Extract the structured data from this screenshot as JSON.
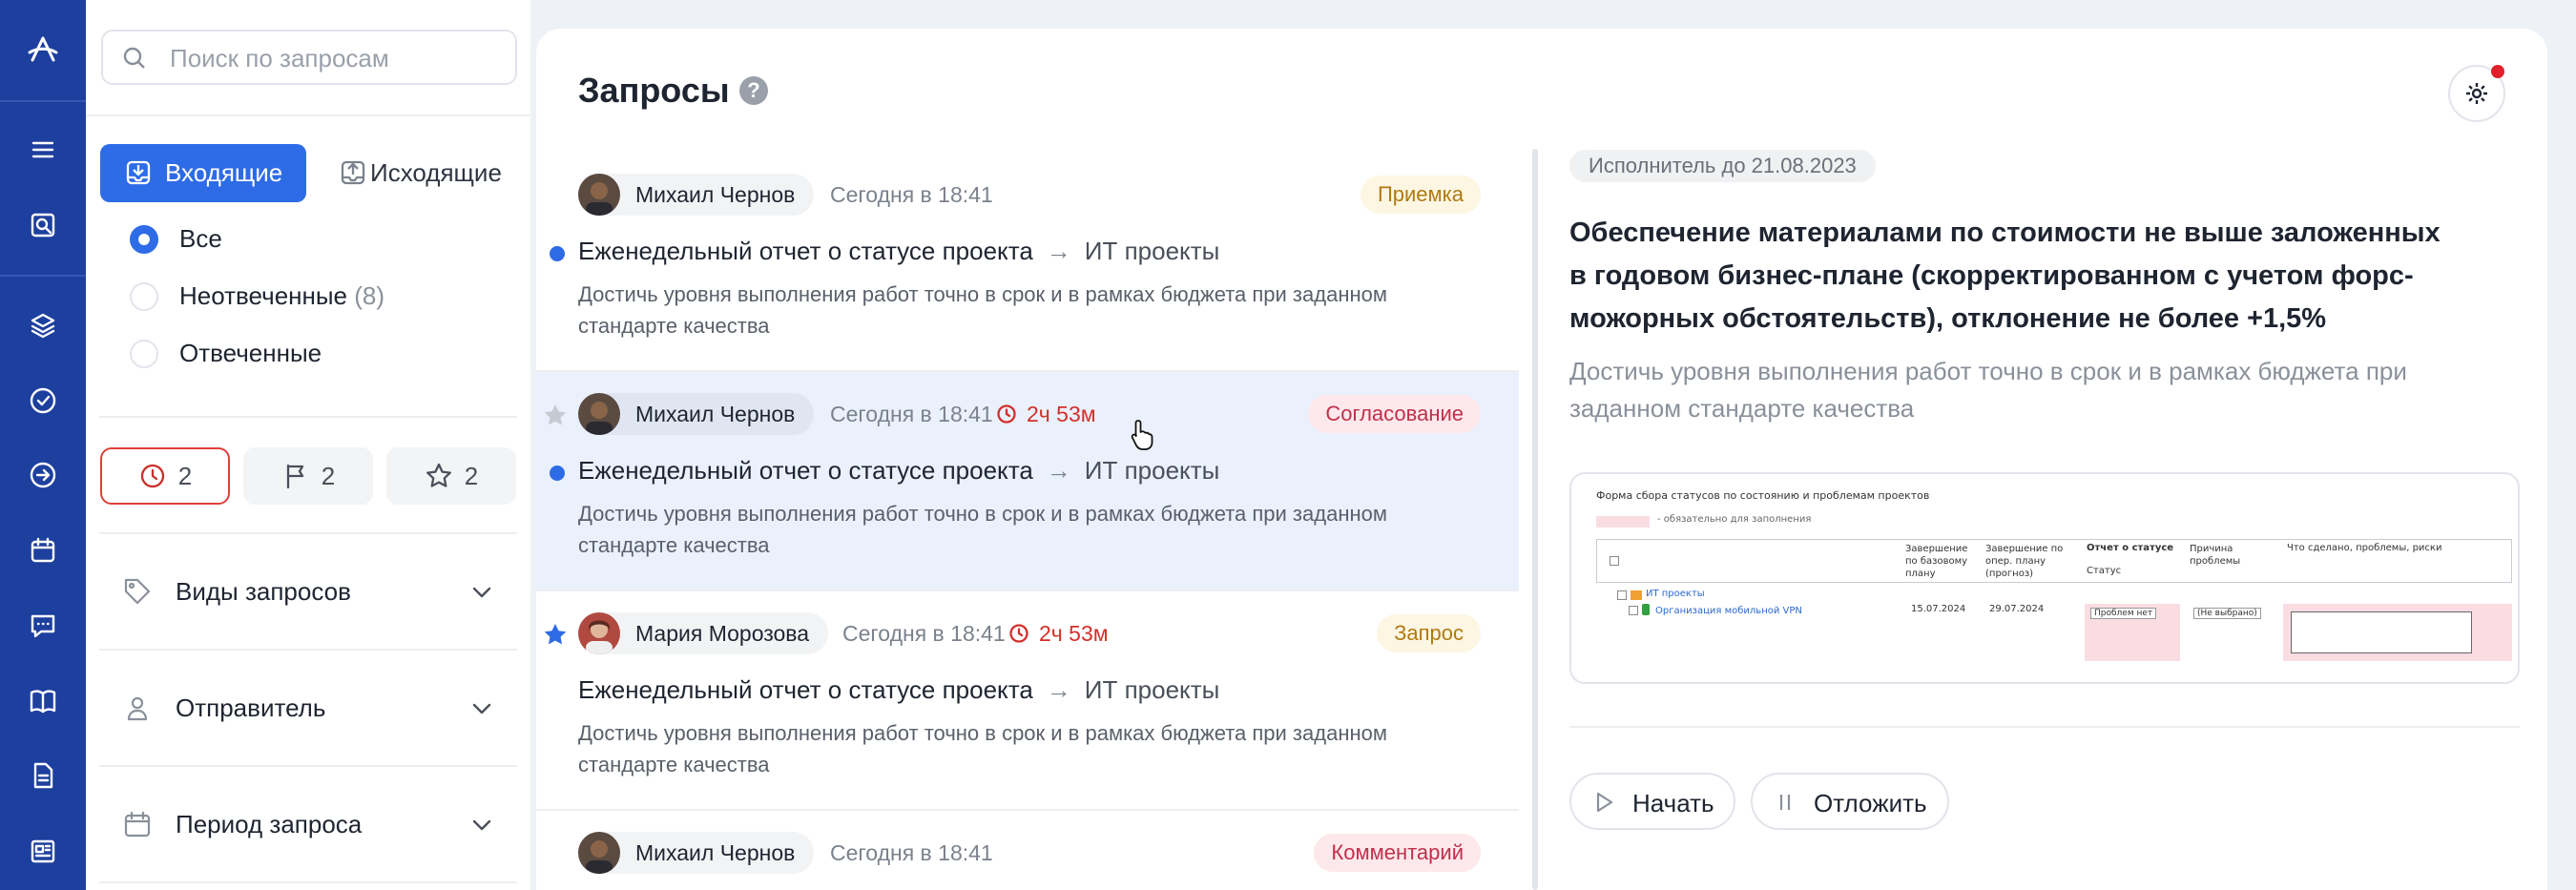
{
  "search": {
    "placeholder": "Поиск по запросам"
  },
  "tabs": {
    "incoming": "Входящие",
    "outgoing": "Исходящие"
  },
  "filters_radio": [
    {
      "label": "Все",
      "count": "",
      "selected": true
    },
    {
      "label": "Неотвеченные",
      "count": "(8)",
      "selected": false
    },
    {
      "label": "Отвеченные",
      "count": "",
      "selected": false
    }
  ],
  "chips": {
    "overdue": "2",
    "flagged": "2",
    "starred": "2"
  },
  "filter_sections": {
    "types": "Виды запросов",
    "sender": "Отправитель",
    "period": "Период запроса"
  },
  "page_title": "Запросы",
  "help_glyph": "?",
  "requests": [
    {
      "author": "Михаил Чернов",
      "time": "Сегодня в 18:41",
      "timer": "",
      "tag": "Приемка",
      "tag_bg": "#fdf6e3",
      "tag_fg": "#b07a12",
      "unread": true,
      "starred": false,
      "subject": "Еженедельный отчет о статусе проекта",
      "arrow": "→",
      "project": "ИТ проекты",
      "description": "Достичь уровня выполнения работ точно в срок и в рамках бюджета при заданном стандарте качества"
    },
    {
      "author": "Михаил Чернов",
      "time": "Сегодня в 18:41",
      "timer": "2ч 53м",
      "tag": "Согласование",
      "tag_bg": "#fde8ec",
      "tag_fg": "#c0304a",
      "unread": true,
      "starred": false,
      "subject": "Еженедельный отчет о статусе проекта",
      "arrow": "→",
      "project": "ИТ проекты",
      "description": "Достичь уровня выполнения работ точно в срок и в рамках бюджета при заданном стандарте качества"
    },
    {
      "author": "Мария Морозова",
      "time": "Сегодня в 18:41",
      "timer": "2ч 53м",
      "tag": "Запрос",
      "tag_bg": "#fdf6e3",
      "tag_fg": "#b07a12",
      "unread": false,
      "starred": true,
      "subject": "Еженедельный отчет о статусе проекта",
      "arrow": "→",
      "project": "ИТ проекты",
      "description": "Достичь уровня выполнения работ точно в срок и в рамках бюджета при заданном стандарте качества"
    },
    {
      "author": "Михаил Чернов",
      "time": "Сегодня в 18:41",
      "timer": "",
      "tag": "Комментарий",
      "tag_bg": "#fde8ec",
      "tag_fg": "#c0304a",
      "unread": false,
      "starred": false,
      "subject": "",
      "arrow": "",
      "project": "",
      "description": ""
    }
  ],
  "detail": {
    "executor": "Исполнитель до 21.08.2023",
    "title": "Обеспечение материалами по стоимости не выше заложенных в годовом бизнес-плане (скорректированном с учетом форс-можорных обстоятельств), отклонение не более +1,5%",
    "text": "Достичь уровня выполнения работ точно в срок и в рамках бюджета при заданном стандарте качества",
    "preview": {
      "title": "Форма сбора статусов по состоянию и проблемам проектов",
      "legend": "- обязательно для заполнения",
      "col_plan": "Завершение по базовому плану",
      "col_oper": "Завершение по опер. плану (прогноз)",
      "col_report": "Отчет о статусе",
      "col_status": "Статус",
      "col_reason": "Причина проблемы",
      "col_done": "Что сделано, проблемы, риски",
      "group": "ИТ проекты",
      "row_name": "Организация мобильной VPN",
      "row_plan": "15.07.2024",
      "row_oper": "29.07.2024",
      "row_status": "Проблем нет",
      "row_reason": "(Не выбрано)"
    },
    "start": "Начать",
    "postpone": "Отложить"
  },
  "colors": {
    "rail": "#1d3f9e",
    "accent": "#2e6be6",
    "danger": "#d2302a",
    "selected_row": "#eaf1fc"
  },
  "icons": [
    "logo-icon",
    "menu-icon",
    "search-doc-icon",
    "layers-icon",
    "check-circle-icon",
    "arrow-circle-icon",
    "calendar-icon",
    "chat-icon",
    "book-icon",
    "document-icon",
    "news-icon"
  ]
}
